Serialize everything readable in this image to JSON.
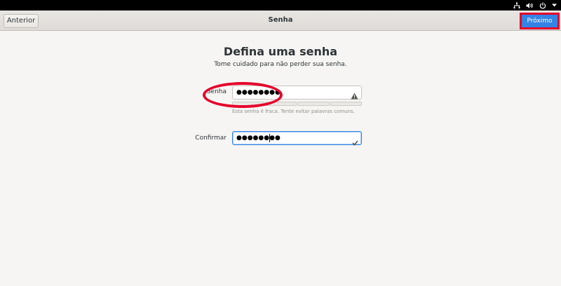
{
  "header": {
    "back_label": "Anterior",
    "title": "Senha",
    "next_label": "Próximo"
  },
  "system_tray": {
    "icons": [
      "network-icon",
      "volume-icon",
      "power-icon",
      "chevron-down-icon"
    ]
  },
  "main": {
    "title": "Defina uma senha",
    "subtitle": "Tome cuidado para não perder sua senha.",
    "password": {
      "label": "Senha",
      "value_masked": "●●●●●●●●",
      "status_icon": "warning-icon",
      "strength_segments": 4,
      "strength_filled": 0,
      "hint": "Esta senha é fraca. Tente evitar palavras comuns."
    },
    "confirm": {
      "label": "Confirmar",
      "value_masked": "●●●●●●●●",
      "status_icon": "check-icon"
    }
  },
  "colors": {
    "accent": "#3584e4",
    "annotation": "#e5002b",
    "background": "#f6f5f4"
  }
}
